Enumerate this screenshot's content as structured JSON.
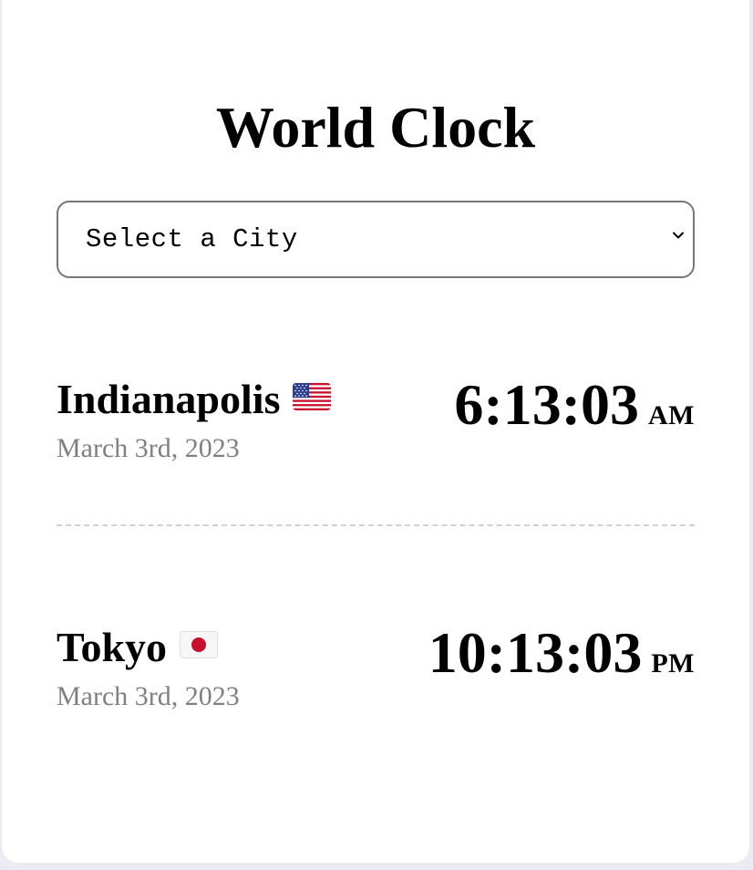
{
  "app": {
    "title": "World Clock"
  },
  "city_select": {
    "selected": "Select a City",
    "chevron_icon": "chevron-down-icon"
  },
  "cities": [
    {
      "name": "Indianapolis",
      "flag": "us-flag-icon",
      "date": "March 3rd, 2023",
      "time": "6:13:03",
      "period": "AM"
    },
    {
      "name": "Tokyo",
      "flag": "japan-flag-icon",
      "date": "March 3rd, 2023",
      "time": "10:13:03",
      "period": "PM"
    }
  ],
  "colors": {
    "background": "#ecebf3",
    "card": "#ffffff",
    "date_text": "#808080",
    "divider": "#d0d0d0",
    "select_border": "#767676"
  }
}
